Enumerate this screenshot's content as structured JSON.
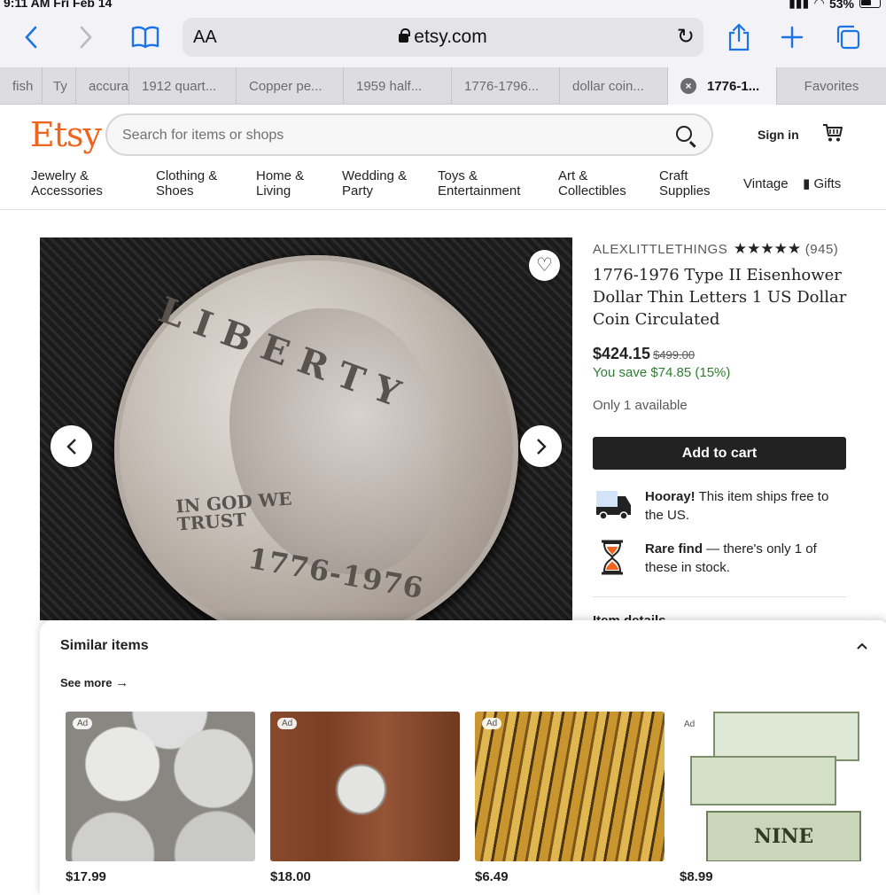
{
  "status": {
    "time": "9:11 AM  Fri Feb 14",
    "battery": "53%"
  },
  "browser": {
    "aa_label": "AA",
    "domain": "etsy.com",
    "tabs": [
      {
        "label": "fish"
      },
      {
        "label": "Ty"
      },
      {
        "label": "accura"
      },
      {
        "label": "1912 quart..."
      },
      {
        "label": "Copper pe..."
      },
      {
        "label": "1959 half..."
      },
      {
        "label": "1776-1796..."
      },
      {
        "label": "dollar coin..."
      },
      {
        "label": "1776-1..."
      },
      {
        "label": "Favorites"
      }
    ]
  },
  "etsy": {
    "logo": "Etsy",
    "search_placeholder": "Search for items or shops",
    "signin": "Sign in",
    "categories": [
      {
        "l1": "Jewelry &",
        "l2": "Accessories"
      },
      {
        "l1": "Clothing &",
        "l2": "Shoes"
      },
      {
        "l1": "Home &",
        "l2": "Living"
      },
      {
        "l1": "Wedding &",
        "l2": "Party"
      },
      {
        "l1": "Toys &",
        "l2": "Entertainment"
      },
      {
        "l1": "Art &",
        "l2": "Collectibles"
      },
      {
        "l1": "Craft",
        "l2": "Supplies"
      },
      {
        "l1": "Vintage",
        "l2": ""
      },
      {
        "l1": "Gifts",
        "l2": ""
      }
    ]
  },
  "listing": {
    "coin_text": {
      "top": "LIBERTY",
      "motto": "IN GOD WE TRUST",
      "date": "1776-1976"
    },
    "shop_name": "ALEXLITTLETHINGS",
    "stars": "★★★★★",
    "review_count": "(945)",
    "title": "1776-1976 Type II Eisenhower Dollar Thin Letters 1 US Dollar Coin Circulated",
    "price": "$424.15",
    "original_price": "$499.00",
    "savings": "You save $74.85 (15%)",
    "availability": "Only 1 available",
    "add_to_cart": "Add to cart",
    "perks": [
      {
        "bold": "Hooray!",
        "text": " This item ships free to the US."
      },
      {
        "bold": "Rare find",
        "text": " — there's only 1 of these in stock."
      }
    ],
    "cut_off_text": "Item details"
  },
  "similar": {
    "heading": "Similar items",
    "see_more": "See more",
    "items": [
      {
        "ad": "Ad",
        "price": "$17.99"
      },
      {
        "ad": "Ad",
        "price": "$18.00"
      },
      {
        "ad": "Ad",
        "price": "$6.49"
      },
      {
        "ad": "Ad",
        "price": "$8.99",
        "banner_text": "NINE"
      }
    ]
  },
  "colors": {
    "etsy_orange": "#f1641e",
    "safari_blue": "#1a73e8",
    "save_green": "#2f7d32"
  }
}
